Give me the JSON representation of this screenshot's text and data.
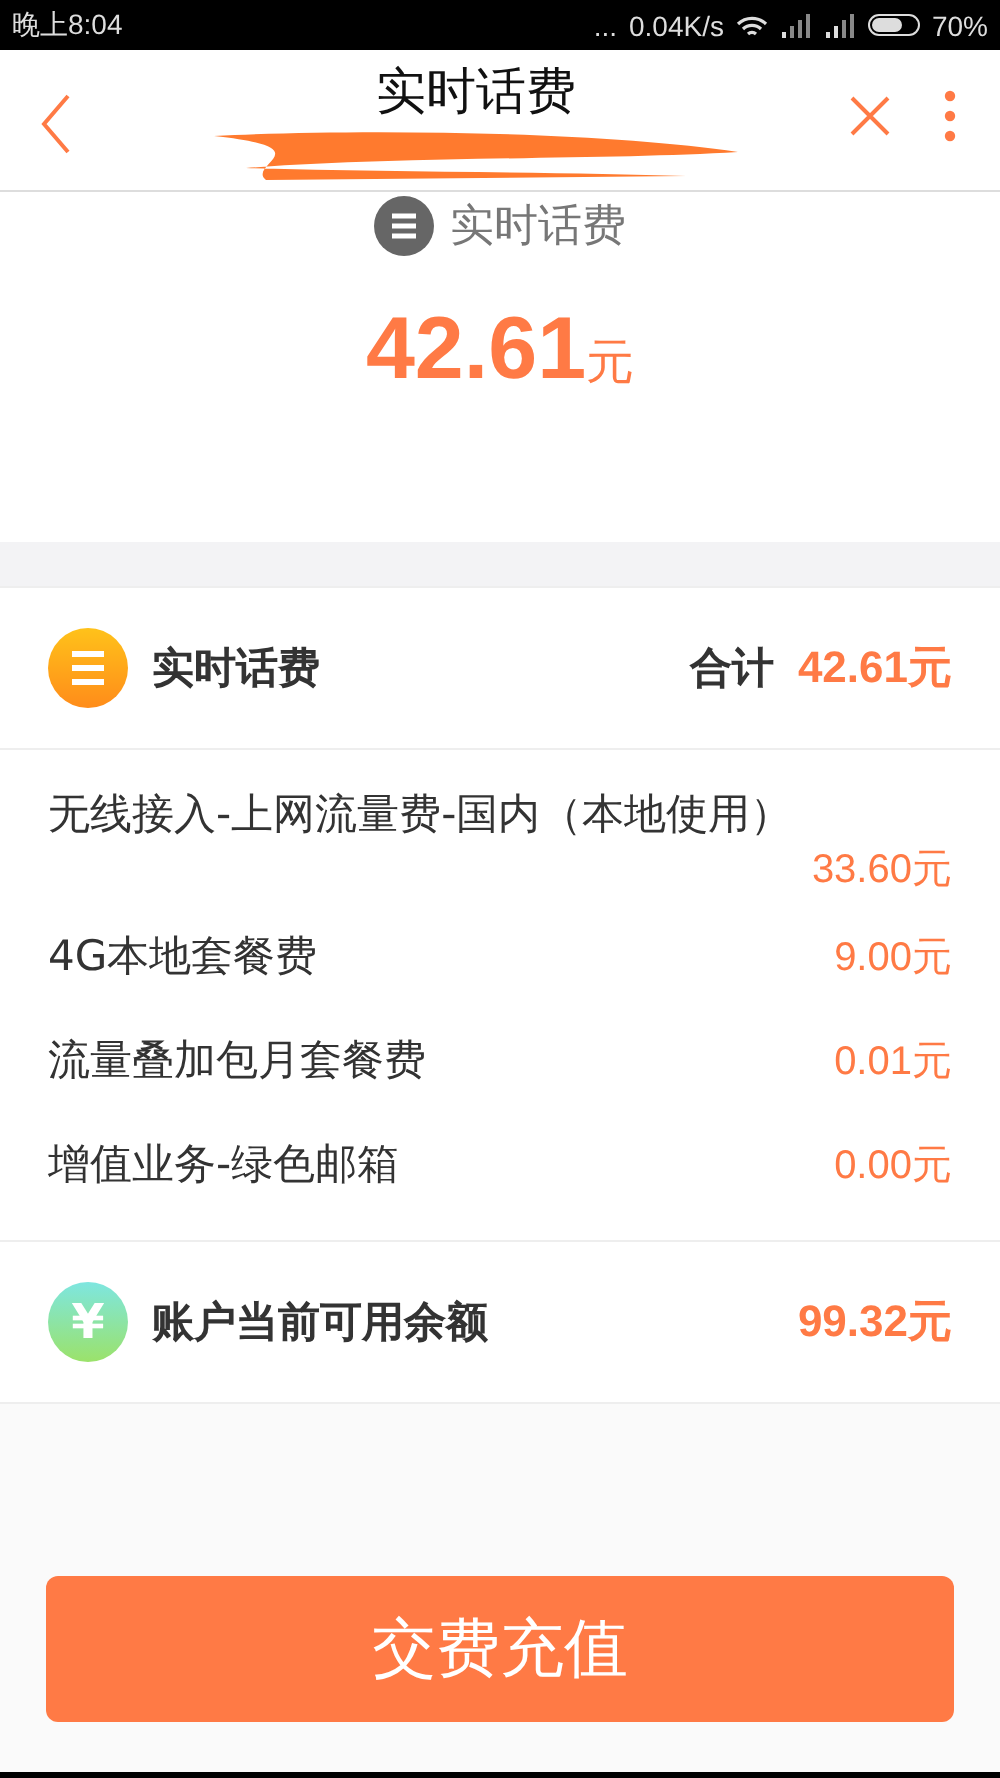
{
  "status_bar": {
    "time": "晚上8:04",
    "dots": "...",
    "speed": "0.04K/s",
    "battery": "70%"
  },
  "header": {
    "title": "实时话费"
  },
  "summary": {
    "label": "实时话费",
    "amount": "42.61",
    "unit": "元"
  },
  "section": {
    "title": "实时话费",
    "total_label": "合计",
    "total": "42.61元"
  },
  "items": [
    {
      "name": "无线接入-上网流量费-国内（本地使用）",
      "amount": "33.60元"
    },
    {
      "name": "4G本地套餐费",
      "amount": "9.00元"
    },
    {
      "name": "流量叠加包月套餐费",
      "amount": "0.01元"
    },
    {
      "name": "增值业务-绿色邮箱",
      "amount": "0.00元"
    }
  ],
  "balance": {
    "icon_glyph": "¥",
    "label": "账户当前可用余额",
    "amount": "99.32元"
  },
  "pay_button": "交费充值"
}
